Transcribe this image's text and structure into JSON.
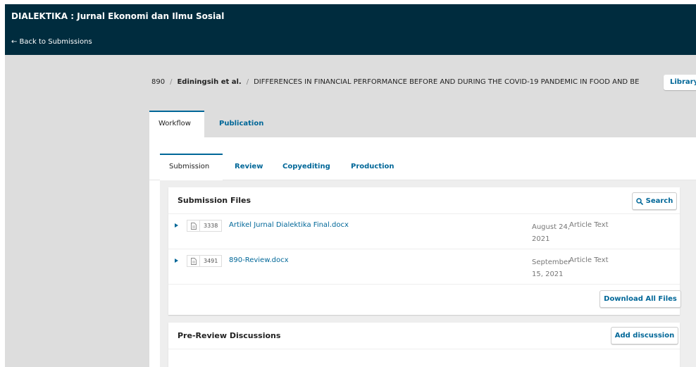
{
  "header": {
    "title": "DIALEKTIKA : Jurnal Ekonomi dan Ilmu Sosial",
    "back_label": "← Back to Submissions"
  },
  "breadcrumb": {
    "id": "890",
    "authors": "Ediningsih et al.",
    "title": "DIFFERENCES IN FINANCIAL PERFORMANCE BEFORE AND DURING THE COVID-19 PANDEMIC IN FOOD AND BE",
    "library_label": "Library"
  },
  "primary_tabs": [
    {
      "label": "Workflow",
      "active": true
    },
    {
      "label": "Publication",
      "active": false
    }
  ],
  "workflow_tabs": [
    {
      "label": "Submission",
      "active": true
    },
    {
      "label": "Review",
      "active": false
    },
    {
      "label": "Copyediting",
      "active": false
    },
    {
      "label": "Production",
      "active": false
    }
  ],
  "submission_files": {
    "title": "Submission Files",
    "search_label": "Search",
    "files": [
      {
        "id": "3338",
        "name": "Artikel Jurnal Dialektika Final.docx",
        "date_line1": "August 24,",
        "date_line2": "2021",
        "type": "Article Text"
      },
      {
        "id": "3491",
        "name": "890-Review.docx",
        "date_line1": "September",
        "date_line2": "15, 2021",
        "type": "Article Text"
      }
    ],
    "download_all_label": "Download All Files"
  },
  "discussions": {
    "title": "Pre-Review Discussions",
    "add_label": "Add discussion"
  },
  "colors": {
    "header_bg": "#002c3e",
    "link": "#006798",
    "page_bg": "#dddddd"
  }
}
